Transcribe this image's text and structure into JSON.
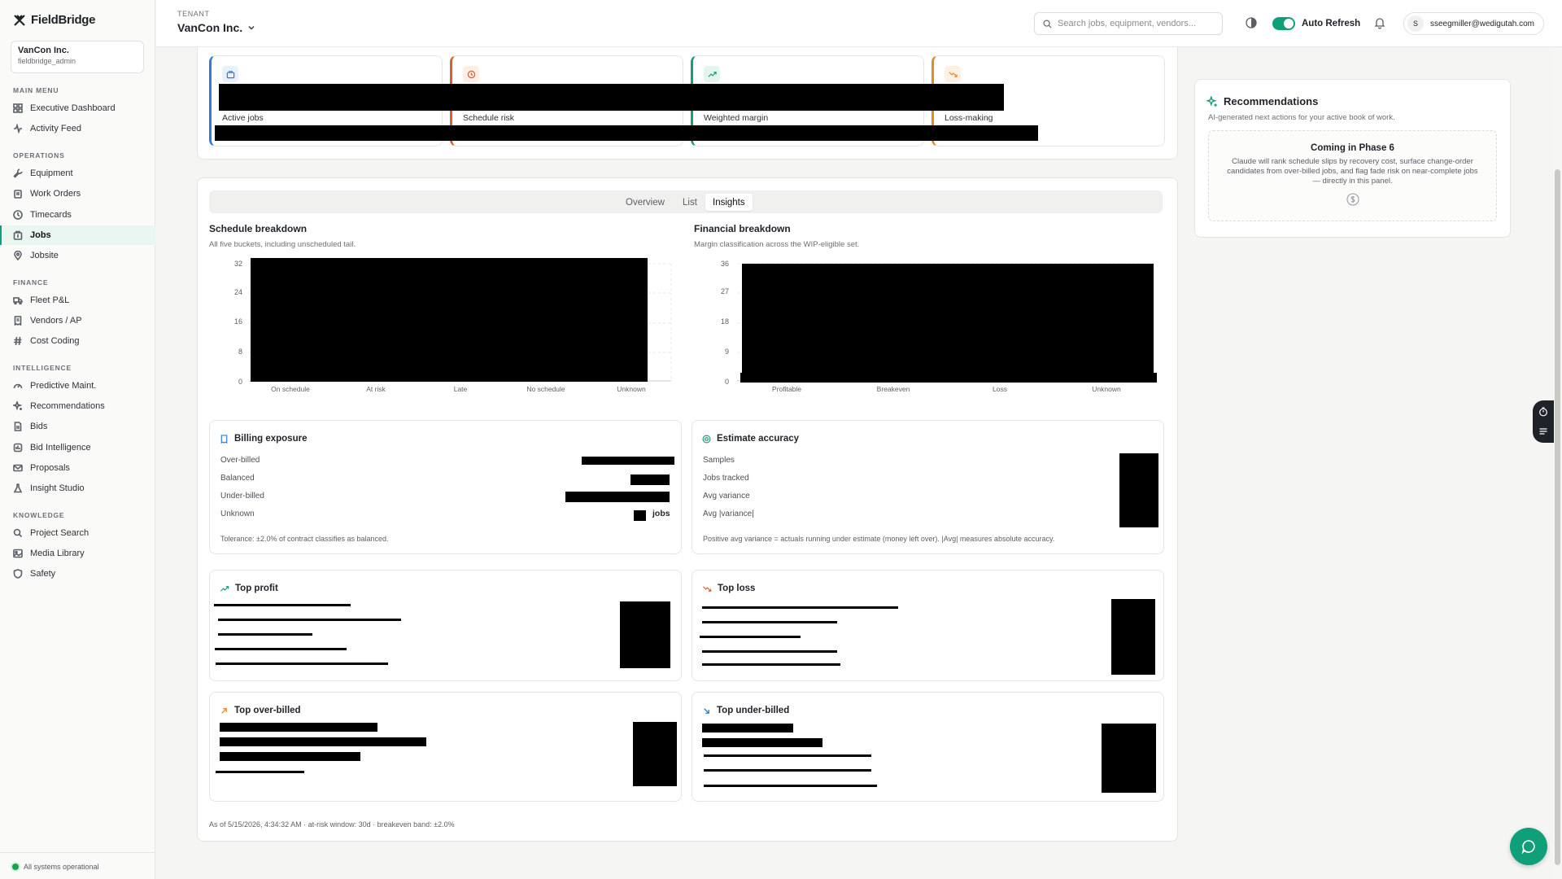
{
  "app": {
    "name": "FieldBridge"
  },
  "tenant_card": {
    "name": "VanCon Inc.",
    "role": "fieldbridge_admin"
  },
  "nav": {
    "main_menu": "MAIN MENU",
    "operations": "OPERATIONS",
    "finance": "FINANCE",
    "intelligence": "INTELLIGENCE",
    "knowledge": "KNOWLEDGE",
    "items": {
      "executive_dashboard": "Executive Dashboard",
      "activity_feed": "Activity Feed",
      "equipment": "Equipment",
      "work_orders": "Work Orders",
      "timecards": "Timecards",
      "jobs": "Jobs",
      "jobsite": "Jobsite",
      "fleet_pl": "Fleet P&L",
      "vendors_ap": "Vendors / AP",
      "cost_coding": "Cost Coding",
      "predictive_maint": "Predictive Maint.",
      "recommendations": "Recommendations",
      "bids": "Bids",
      "bid_intelligence": "Bid Intelligence",
      "proposals": "Proposals",
      "insight_studio": "Insight Studio",
      "project_search": "Project Search",
      "media_library": "Media Library",
      "safety": "Safety"
    },
    "status": "All systems operational"
  },
  "topbar": {
    "tenant_label": "TENANT",
    "tenant_name": "VanCon Inc.",
    "search_placeholder": "Search jobs, equipment, vendors...",
    "auto_refresh": "Auto Refresh",
    "auto_refresh_on": true,
    "user_initial": "S",
    "user_email": "sseegmiller@wedigutah.com"
  },
  "kpis": [
    {
      "label": "Active jobs",
      "icon": "briefcase-icon",
      "accent": "#2f7bd8"
    },
    {
      "label": "Schedule risk",
      "icon": "clock-icon",
      "accent": "#d9612b"
    },
    {
      "label": "Weighted margin",
      "icon": "trending-up-icon",
      "accent": "#1a9c7a"
    },
    {
      "label": "Loss-making",
      "icon": "trending-down-icon",
      "accent": "#e08a2c"
    }
  ],
  "tabs": {
    "overview": "Overview",
    "list": "List",
    "insights": "Insights",
    "active": "Insights"
  },
  "schedule": {
    "title": "Schedule breakdown",
    "subtitle": "All five buckets, including unscheduled tail.",
    "yticks": [
      "32",
      "24",
      "16",
      "8",
      "0"
    ],
    "categories": [
      "On schedule",
      "At risk",
      "Late",
      "No schedule",
      "Unknown"
    ]
  },
  "financial": {
    "title": "Financial breakdown",
    "subtitle": "Margin classification across the WIP-eligible set.",
    "yticks": [
      "36",
      "27",
      "18",
      "9",
      "0"
    ],
    "categories": [
      "Profitable",
      "Breakeven",
      "Loss",
      "Unknown"
    ]
  },
  "billing": {
    "title": "Billing exposure",
    "rows": [
      "Over-billed",
      "Balanced",
      "Under-billed",
      "Unknown"
    ],
    "unknown_suffix": "jobs",
    "note": "Tolerance: ±2.0% of contract classifies as balanced."
  },
  "estimate": {
    "title": "Estimate accuracy",
    "rows": [
      "Samples",
      "Jobs tracked",
      "Avg variance",
      "Avg |variance|"
    ],
    "note": "Positive avg variance = actuals running under estimate (money left over). |Avg| measures absolute accuracy."
  },
  "top_profit": {
    "title": "Top profit"
  },
  "top_loss": {
    "title": "Top loss"
  },
  "top_over": {
    "title": "Top over-billed"
  },
  "top_under": {
    "title": "Top under-billed"
  },
  "recommendations": {
    "title": "Recommendations",
    "subtitle": "AI-generated next actions for your active book of work.",
    "box_title": "Coming in Phase 6",
    "box_text": "Claude will rank schedule slips by recovery cost, surface change-order candidates from over-billed jobs, and flag fade risk on near-complete jobs — directly in this panel."
  },
  "footer": "As of 5/15/2026, 4:34:32 AM · at-risk window: 30d · breakeven band: ±2.0%"
}
